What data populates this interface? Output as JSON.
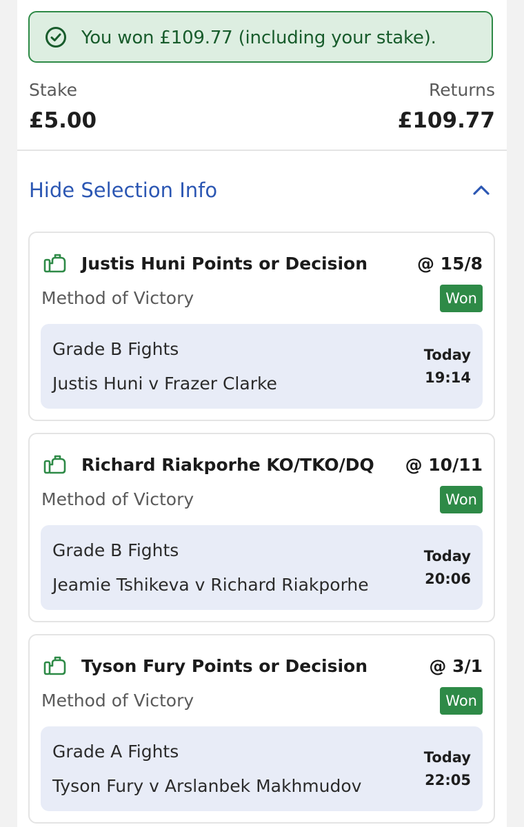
{
  "result_alert": {
    "message": "You won £109.77 (including your stake).",
    "icon": "check-circle-icon",
    "color": "#2e8a47"
  },
  "summary": {
    "stake_label": "Stake",
    "stake_value": "£5.00",
    "returns_label": "Returns",
    "returns_value": "£109.77"
  },
  "selection_toggle": {
    "label": "Hide Selection Info",
    "icon": "chevron-up-icon",
    "color": "#2c57b3"
  },
  "selections": [
    {
      "name": "Justis Huni Points or Decision",
      "odds": "@ 15/8",
      "market": "Method of Victory",
      "status": "Won",
      "competition": "Grade B Fights",
      "fixture": "Justis Huni v Frazer Clarke",
      "day": "Today",
      "time": "19:14"
    },
    {
      "name": "Richard Riakporhe KO/TKO/DQ",
      "odds": "@ 10/11",
      "market": "Method of Victory",
      "status": "Won",
      "competition": "Grade B Fights",
      "fixture": "Jeamie Tshikeva v Richard Riakporhe",
      "day": "Today",
      "time": "20:06"
    },
    {
      "name": "Tyson Fury Points or Decision",
      "odds": "@ 3/1",
      "market": "Method of Victory",
      "status": "Won",
      "competition": "Grade A Fights",
      "fixture": "Tyson Fury v Arslanbek Makhmudov",
      "day": "Today",
      "time": "22:05"
    }
  ],
  "icons": {
    "selection": "boxing-glove-icon"
  }
}
